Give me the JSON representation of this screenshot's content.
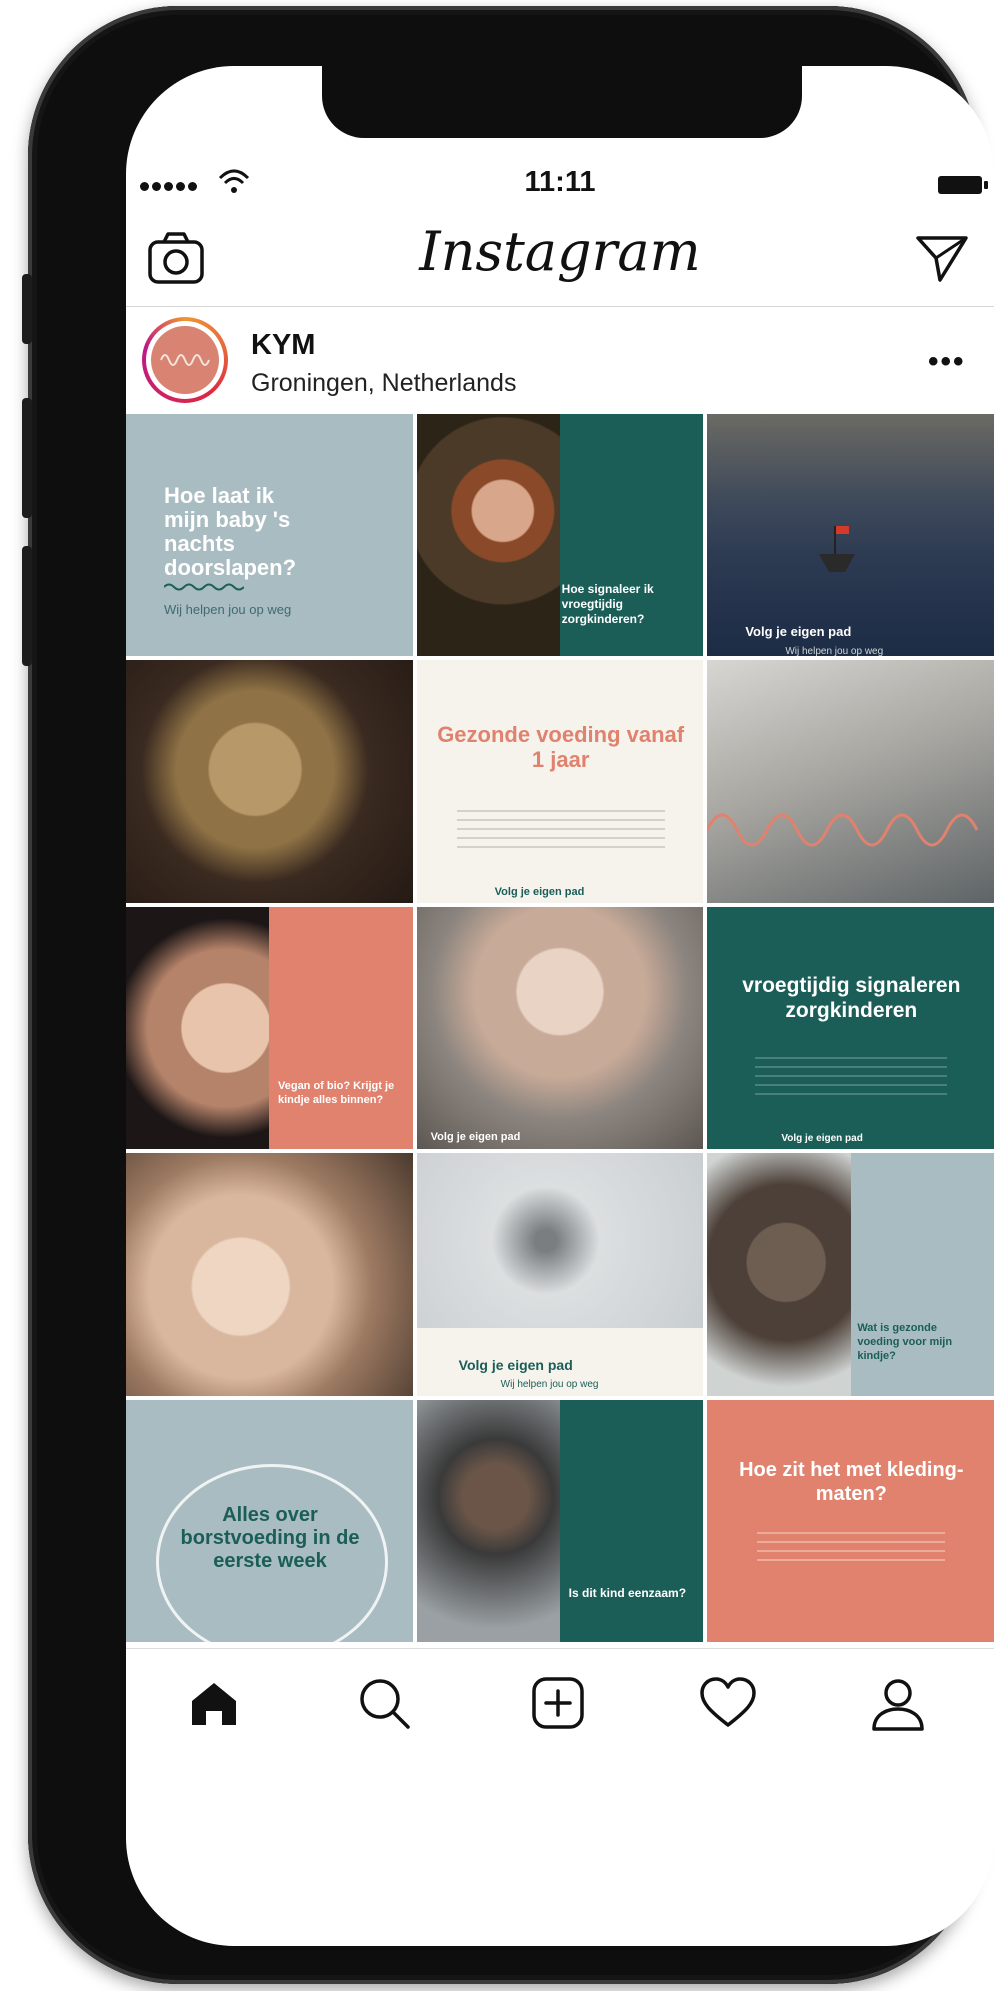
{
  "status_bar": {
    "time": "11:11"
  },
  "header": {
    "logo": "Instagram",
    "left_icon": "camera-icon",
    "right_icon": "send-icon"
  },
  "profile": {
    "username": "KYM",
    "location": "Groningen, Netherlands",
    "more": "•••"
  },
  "colors": {
    "slate": "#a9bcc2",
    "teal": "#1b5e58",
    "salmon": "#e0826d",
    "cream": "#f6f2ec"
  },
  "posts": [
    {
      "title": "Hoe laat ik mijn baby 's nachts doorslapen?",
      "subtitle": "Wij helpen jou op weg"
    },
    {
      "title": "Hoe signaleer ik vroegtijdig zorgkinderen?"
    },
    {
      "title": "Volg je eigen pad",
      "subtitle": "Wij helpen jou op weg"
    },
    {
      "title": ""
    },
    {
      "title": "Gezonde voeding vanaf 1 jaar",
      "footer": "Volg je eigen pad"
    },
    {
      "title": ""
    },
    {
      "title": "Vegan of bio? Krijgt je kindje alles binnen?"
    },
    {
      "title": "Volg je eigen pad"
    },
    {
      "title": "vroegtijdig signaleren zorgkinderen",
      "footer": "Volg je eigen pad"
    },
    {
      "title": ""
    },
    {
      "title": "Volg je eigen pad",
      "subtitle": "Wij helpen jou op weg"
    },
    {
      "title": "Wat is gezonde voeding voor mijn kindje?"
    },
    {
      "title": "Alles over borstvoeding in de eerste week"
    },
    {
      "title": "Is dit kind eenzaam?"
    },
    {
      "title": "Hoe zit het met kleding-maten?"
    }
  ],
  "nav": {
    "items": [
      "home-icon",
      "search-icon",
      "add-post-icon",
      "heart-icon",
      "profile-icon"
    ]
  }
}
